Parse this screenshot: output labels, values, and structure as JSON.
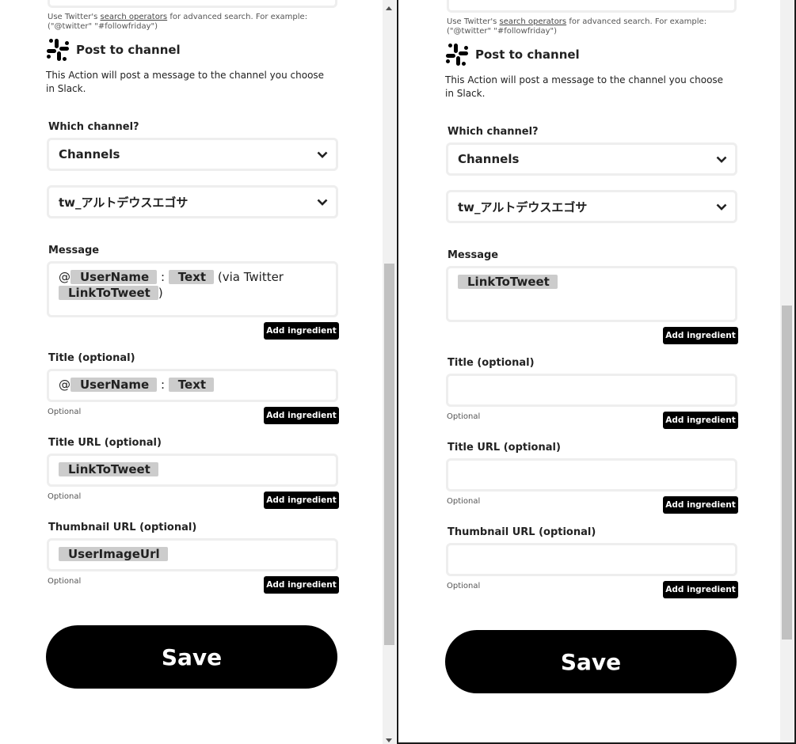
{
  "left": {
    "help_prefix": "Use Twitter's ",
    "help_link": "search operators",
    "help_suffix": " for advanced search. For example:",
    "help_line2": "(\"@twitter\" \"#followfriday\")",
    "action_title": "Post to channel",
    "action_desc": "This Action will post a message to the channel you choose in Slack.",
    "channel_label": "Which channel?",
    "channel_type": "Channels",
    "channel_name": "tw_アルトデウスエゴサ",
    "message_label": "Message",
    "message": {
      "at": "@",
      "user_name": "UserName",
      "colon": ":",
      "text": "Text",
      "via": "(via Twitter",
      "link": "LinkToTweet",
      "close": ")"
    },
    "add_ingredient": "Add ingredient",
    "title_label": "Title (optional)",
    "title": {
      "at": "@",
      "user_name": "UserName",
      "colon": ":",
      "text": "Text"
    },
    "optional": "Optional",
    "title_url_label": "Title URL (optional)",
    "title_url_value": "LinkToTweet",
    "thumbnail_label": "Thumbnail URL (optional)",
    "thumbnail_value": "UserImageUrl",
    "save": "Save"
  },
  "right": {
    "help_prefix": "Use Twitter's ",
    "help_link": "search operators",
    "help_suffix": " for advanced search. For example:",
    "help_line2": "(\"@twitter\" \"#followfriday\")",
    "action_title": "Post to channel",
    "action_desc": "This Action will post a message to the channel you choose in Slack.",
    "channel_label": "Which channel?",
    "channel_type": "Channels",
    "channel_name": "tw_アルトデウスエゴサ",
    "message_label": "Message",
    "message_link": "LinkToTweet",
    "add_ingredient": "Add ingredient",
    "title_label": "Title (optional)",
    "optional": "Optional",
    "title_url_label": "Title URL (optional)",
    "thumbnail_label": "Thumbnail URL (optional)",
    "save": "Save"
  },
  "colors": {
    "accent": "#000000",
    "pill": "#cccccc",
    "border": "#eeeeee"
  },
  "icons": [
    "slack-icon",
    "chevron-down-icon"
  ]
}
